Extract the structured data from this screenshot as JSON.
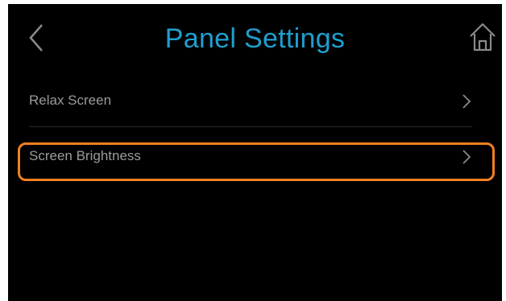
{
  "header": {
    "title": "Panel Settings",
    "back_icon": "chevron-left-icon",
    "home_icon": "home-icon",
    "title_color": "#1f9fcf"
  },
  "menu": {
    "items": [
      {
        "label": "Relax Screen",
        "icon": "chevron-right-icon"
      },
      {
        "label": "Screen Brightness",
        "icon": "chevron-right-icon",
        "highlighted": true
      }
    ]
  },
  "colors": {
    "background": "#000000",
    "text": "#9b9b9b",
    "highlight": "#f38021"
  }
}
